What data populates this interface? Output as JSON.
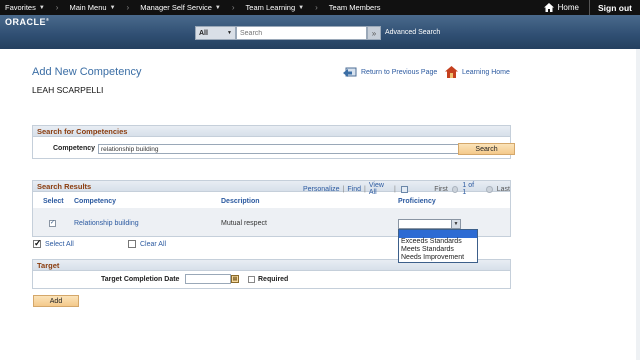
{
  "nav": {
    "items": [
      {
        "label": "Favorites",
        "caret": true
      },
      {
        "label": "Main Menu",
        "caret": true
      },
      {
        "label": "Manager Self Service",
        "caret": true
      },
      {
        "label": "Team Learning",
        "caret": true
      },
      {
        "label": "Team Members",
        "caret": false
      }
    ],
    "home": "Home",
    "signout": "Sign out"
  },
  "banner": {
    "logo": "ORACLE",
    "search_scope": "All",
    "search_placeholder": "Search",
    "advanced_search": "Advanced Search"
  },
  "page": {
    "title": "Add New Competency",
    "person": "LEAH SCARPELLI",
    "return_link": "Return to Previous Page",
    "learning_home": "Learning Home"
  },
  "search_panel": {
    "header": "Search for Competencies",
    "label": "Competency",
    "value": "relationship building",
    "button": "Search"
  },
  "results": {
    "header": "Search Results",
    "personalize": "Personalize",
    "find": "Find",
    "view_all": "View All",
    "first": "First",
    "count": "1 of 1",
    "last": "Last",
    "columns": [
      "Select",
      "Competency",
      "Description",
      "Proficiency"
    ],
    "rows": [
      {
        "selected": true,
        "competency": "Relationship building",
        "description": "Mutual respect",
        "proficiency": ""
      }
    ],
    "select_all": "Select All",
    "clear_all": "Clear All"
  },
  "proficiency_options": [
    "",
    "Exceeds Standards",
    "Meets Standards",
    "Needs Improvement"
  ],
  "target": {
    "header": "Target",
    "date_label": "Target Completion Date",
    "date_value": "",
    "required_label": "Required",
    "required": false
  },
  "add_button": "Add",
  "colors": {
    "nav_bg": "#111111",
    "banner": "#2f4e72",
    "title": "#3b6ea5",
    "section_header": "#8a3c0e",
    "button": "#f4c98b",
    "selected_option": "#2d6bd3"
  }
}
